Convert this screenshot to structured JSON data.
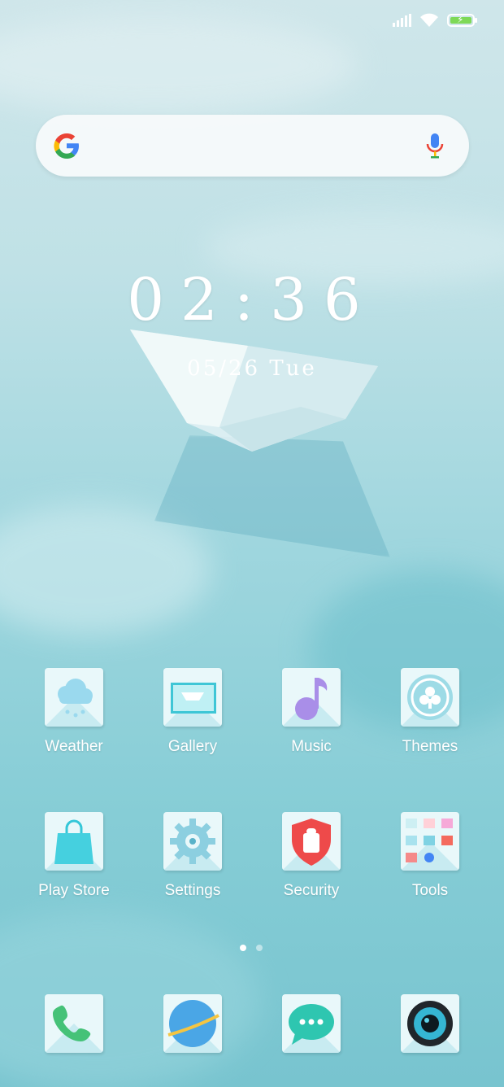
{
  "status": {
    "signal_icon": "cellular-signal-icon",
    "wifi_icon": "wifi-icon",
    "battery_icon": "battery-charging-icon",
    "battery_color": "#7ed957"
  },
  "search": {
    "logo": "google-logo",
    "mic_icon": "mic-icon"
  },
  "clock": {
    "time": "02:36",
    "date": "05/26 Tue"
  },
  "apps": [
    {
      "label": "Weather",
      "icon": "weather-icon"
    },
    {
      "label": "Gallery",
      "icon": "gallery-icon"
    },
    {
      "label": "Music",
      "icon": "music-icon"
    },
    {
      "label": "Themes",
      "icon": "themes-icon"
    },
    {
      "label": "Play Store",
      "icon": "play-store-icon"
    },
    {
      "label": "Settings",
      "icon": "settings-icon"
    },
    {
      "label": "Security",
      "icon": "security-icon"
    },
    {
      "label": "Tools",
      "icon": "tools-folder-icon"
    }
  ],
  "pages": {
    "count": 2,
    "active": 0
  },
  "dock": [
    {
      "icon": "phone-icon"
    },
    {
      "icon": "browser-icon"
    },
    {
      "icon": "messages-icon"
    },
    {
      "icon": "camera-icon"
    }
  ]
}
